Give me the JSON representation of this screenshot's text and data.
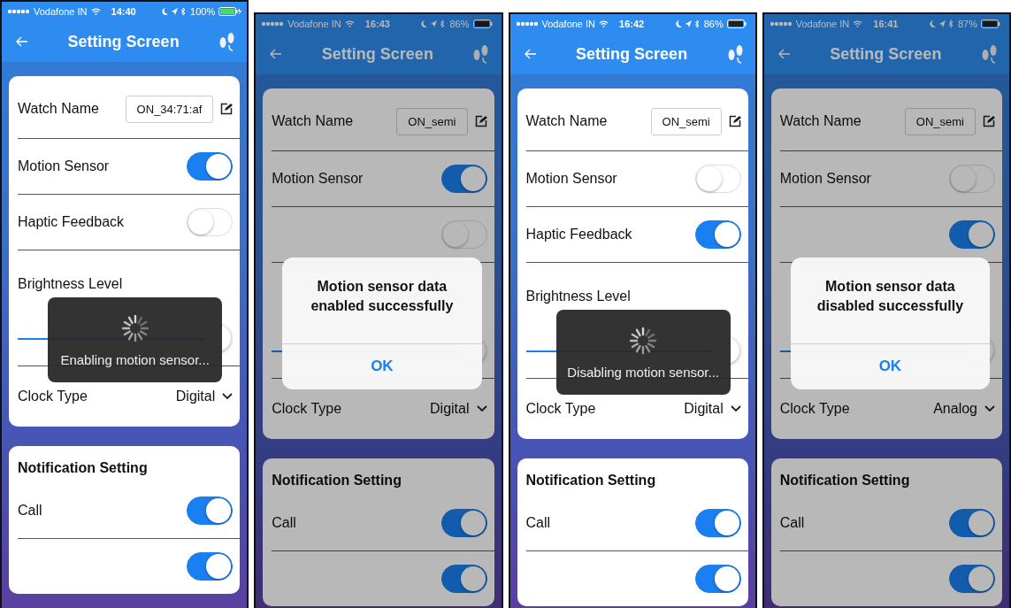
{
  "phones": [
    {
      "status": {
        "carrier": "Vodafone IN",
        "time": "14:40",
        "battery": "100%",
        "charging": true
      },
      "title": "Setting Screen",
      "rows": [
        {
          "kind": "field",
          "label": "Watch Name",
          "value": "ON_34:71:af"
        },
        {
          "kind": "toggle",
          "label": "Motion Sensor",
          "on": true
        },
        {
          "kind": "toggle",
          "label": "Haptic Feedback",
          "on": false
        },
        {
          "kind": "slider",
          "label": "Brightness Level",
          "level": 1
        },
        {
          "kind": "select",
          "label": "Clock Type",
          "value": "Digital"
        }
      ],
      "notification": {
        "title": "Notification Setting",
        "rows": [
          {
            "label": "Call",
            "on": true
          },
          {
            "on": true
          }
        ]
      },
      "overlay": {
        "kind": "toast",
        "message": "Enabling motion sensor..."
      }
    },
    {
      "status": {
        "carrier": "Vodafone IN",
        "time": "16:43",
        "battery": "86%",
        "charging": false
      },
      "title": "Setting Screen",
      "rows": [
        {
          "kind": "field",
          "label": "Watch Name",
          "value": "ON_semi"
        },
        {
          "kind": "toggle",
          "label": "Motion Sensor",
          "on": true
        },
        {
          "kind": "toggle",
          "on": false
        },
        {
          "kind": "slider",
          "level": 1
        },
        {
          "kind": "select",
          "label": "Clock Type",
          "value": "Digital"
        }
      ],
      "notification": {
        "title": "Notification Setting",
        "rows": [
          {
            "label": "Call",
            "on": true
          },
          {
            "on": true
          }
        ]
      },
      "overlay": {
        "kind": "alert",
        "message": "Motion sensor data enabled successfully",
        "button": "OK"
      }
    },
    {
      "status": {
        "carrier": "Vodafone IN",
        "time": "16:42",
        "battery": "86%",
        "charging": false
      },
      "title": "Setting Screen",
      "rows": [
        {
          "kind": "field",
          "label": "Watch Name",
          "value": "ON_semi"
        },
        {
          "kind": "toggle",
          "label": "Motion Sensor",
          "on": false
        },
        {
          "kind": "toggle",
          "label": "Haptic Feedback",
          "on": true
        },
        {
          "kind": "slider",
          "label": "Brightness Level",
          "level": 1
        },
        {
          "kind": "select",
          "label": "Clock Type",
          "value": "Digital"
        }
      ],
      "notification": {
        "title": "Notification Setting",
        "rows": [
          {
            "label": "Call",
            "on": true
          },
          {
            "on": true
          }
        ]
      },
      "overlay": {
        "kind": "toast",
        "message": "Disabling motion sensor..."
      }
    },
    {
      "status": {
        "carrier": "Vodafone IN",
        "time": "16:41",
        "battery": "87%",
        "charging": false
      },
      "title": "Setting Screen",
      "rows": [
        {
          "kind": "field",
          "label": "Watch Name",
          "value": "ON_semi"
        },
        {
          "kind": "toggle",
          "label": "Motion Sensor",
          "on": false
        },
        {
          "kind": "toggle",
          "on": true
        },
        {
          "kind": "slider",
          "level": 1
        },
        {
          "kind": "select",
          "label": "Clock Type",
          "value": "Analog"
        }
      ],
      "notification": {
        "title": "Notification Setting",
        "rows": [
          {
            "label": "Call",
            "on": true
          },
          {
            "on": true
          }
        ]
      },
      "overlay": {
        "kind": "alert",
        "message": "Motion sensor data disabled successfully",
        "button": "OK"
      }
    }
  ]
}
